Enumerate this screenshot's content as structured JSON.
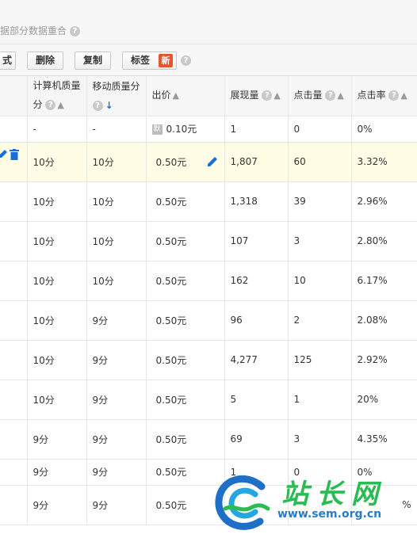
{
  "top_note": {
    "text": "据部分数据重合"
  },
  "toolbar": {
    "buttons": [
      "式",
      "删除",
      "复制",
      "标签"
    ],
    "new_badge": "新"
  },
  "table": {
    "headers": [
      {
        "line1": "",
        "line2": ""
      },
      {
        "line1": "计算机质量",
        "line2": "分"
      },
      {
        "line1": "移动质量分",
        "line2": ""
      },
      {
        "line1": "出价",
        "line2": ""
      },
      {
        "line1": "展现量",
        "line2": ""
      },
      {
        "line1": "点击量",
        "line2": ""
      },
      {
        "line1": "点击率",
        "line2": ""
      }
    ],
    "rows": [
      {
        "pc": "-",
        "mobile": "-",
        "bid_icon": "默",
        "bid": "0.10元",
        "impr": "1",
        "clicks": "0",
        "ctr": "0%"
      },
      {
        "pc": "10分",
        "mobile": "10分",
        "bid_icon": "",
        "bid": "0.50元",
        "impr": "1,807",
        "clicks": "60",
        "ctr": "3.32%"
      },
      {
        "pc": "10分",
        "mobile": "10分",
        "bid_icon": "",
        "bid": "0.50元",
        "impr": "1,318",
        "clicks": "39",
        "ctr": "2.96%"
      },
      {
        "pc": "10分",
        "mobile": "10分",
        "bid_icon": "",
        "bid": "0.50元",
        "impr": "107",
        "clicks": "3",
        "ctr": "2.80%"
      },
      {
        "pc": "10分",
        "mobile": "10分",
        "bid_icon": "",
        "bid": "0.50元",
        "impr": "162",
        "clicks": "10",
        "ctr": "6.17%"
      },
      {
        "pc": "10分",
        "mobile": "9分",
        "bid_icon": "",
        "bid": "0.50元",
        "impr": "96",
        "clicks": "2",
        "ctr": "2.08%"
      },
      {
        "pc": "10分",
        "mobile": "9分",
        "bid_icon": "",
        "bid": "0.50元",
        "impr": "4,277",
        "clicks": "125",
        "ctr": "2.92%"
      },
      {
        "pc": "10分",
        "mobile": "9分",
        "bid_icon": "",
        "bid": "0.50元",
        "impr": "5",
        "clicks": "1",
        "ctr": "20%"
      },
      {
        "pc": "9分",
        "mobile": "9分",
        "bid_icon": "",
        "bid": "0.50元",
        "impr": "69",
        "clicks": "3",
        "ctr": "4.35%"
      },
      {
        "pc": "9分",
        "mobile": "9分",
        "bid_icon": "",
        "bid": "0.50元",
        "impr": "1",
        "clicks": "0",
        "ctr": "0%"
      },
      {
        "pc": "9分",
        "mobile": "9分",
        "bid_icon": "",
        "bid": "0.50元",
        "impr": "",
        "clicks": "",
        "ctr": "%"
      }
    ]
  },
  "watermark": {
    "name": "站长网",
    "url": "www.sem.org.cn"
  },
  "colors": {
    "accent_blue": "#1a6fd6",
    "badge_red": "#e8542e",
    "highlight_row": "#fffde6"
  }
}
